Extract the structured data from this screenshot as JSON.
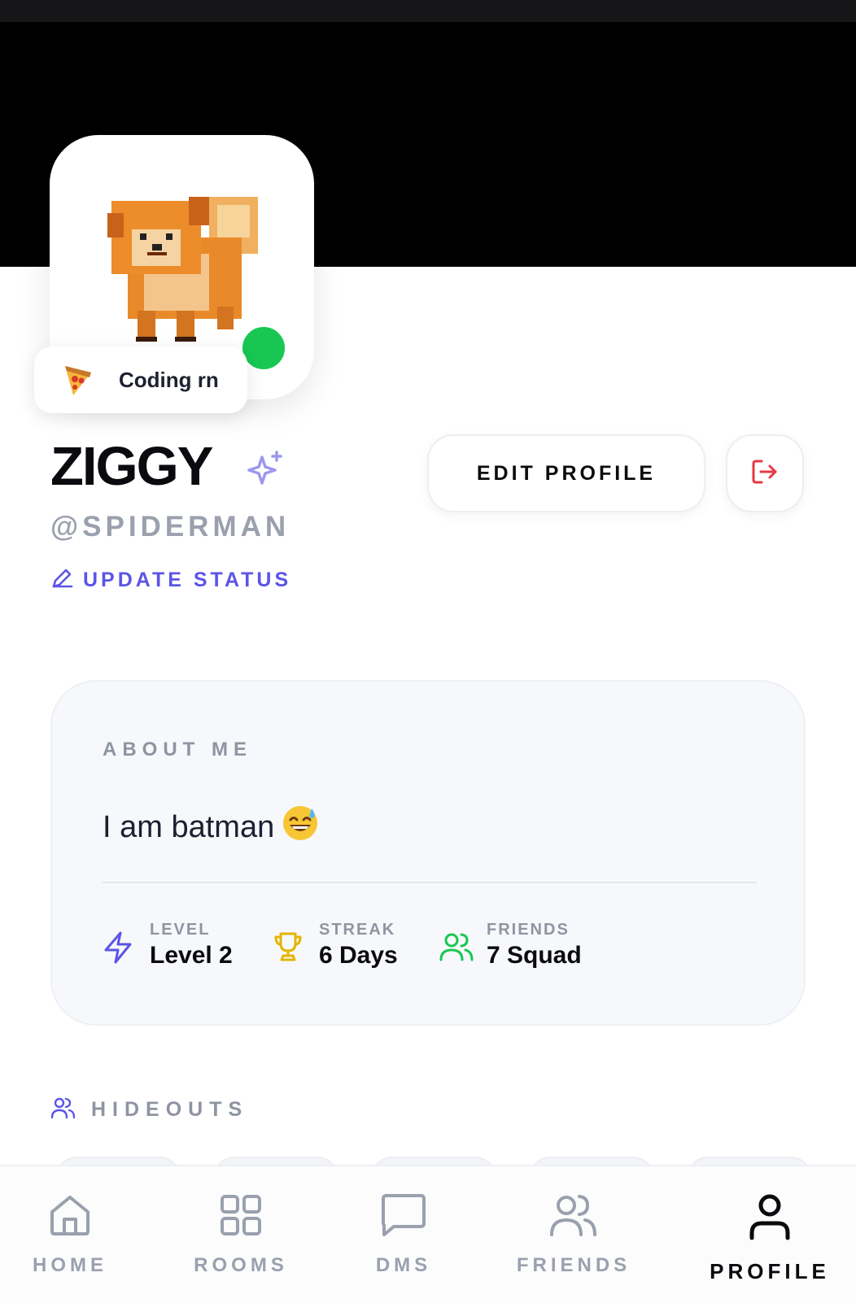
{
  "profile": {
    "display_name": "ZIGGY",
    "handle": "@SPIDERMAN",
    "status_text": "Coding rn",
    "update_status_label": "UPDATE STATUS",
    "online_color": "#18c752"
  },
  "actions": {
    "edit_profile_label": "EDIT PROFILE",
    "logout_icon": "logout-icon"
  },
  "about": {
    "heading": "ABOUT ME",
    "bio": "I am batman",
    "bio_emoji": "grinning-sweat-emoji",
    "stats": [
      {
        "label": "LEVEL",
        "value": "Level 2",
        "icon": "lightning-icon",
        "color": "#5b55e6"
      },
      {
        "label": "STREAK",
        "value": "6 Days",
        "icon": "trophy-icon",
        "color": "#e6b400"
      },
      {
        "label": "FRIENDS",
        "value": "7 Squad",
        "icon": "users-icon",
        "color": "#18c752"
      }
    ]
  },
  "hideouts": {
    "heading": "HIDEOUTS"
  },
  "nav": {
    "items": [
      {
        "label": "HOME",
        "icon": "home-icon",
        "active": false
      },
      {
        "label": "ROOMS",
        "icon": "grid-icon",
        "active": false
      },
      {
        "label": "DMS",
        "icon": "chat-icon",
        "active": false
      },
      {
        "label": "FRIENDS",
        "icon": "friends-icon",
        "active": false
      },
      {
        "label": "PROFILE",
        "icon": "user-icon",
        "active": true
      }
    ]
  },
  "colors": {
    "accent": "#5b55e6",
    "danger": "#e53946",
    "muted": "#9ba0ad"
  }
}
